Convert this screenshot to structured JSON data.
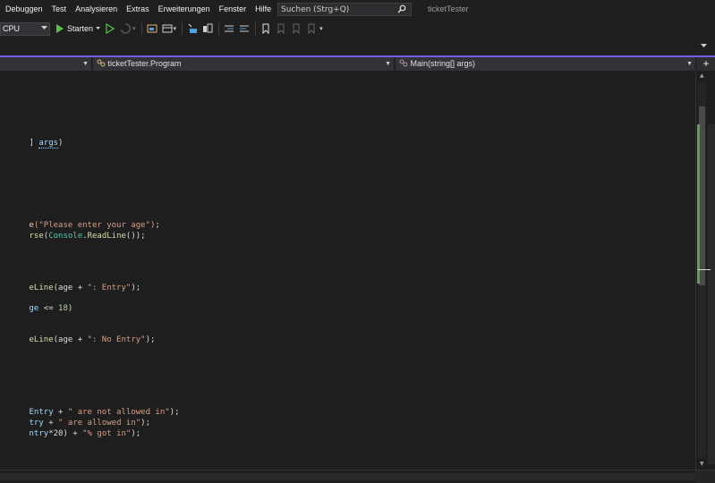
{
  "menu": {
    "items": [
      "Debuggen",
      "Test",
      "Analysieren",
      "Extras",
      "Erweiterungen",
      "Fenster",
      "Hilfe"
    ],
    "search_placeholder": "Suchen (Strg+Q)",
    "window_title": "ticketTester"
  },
  "toolbar": {
    "platform": "CPU",
    "start_label": "Starten"
  },
  "navbar": {
    "project": "",
    "class_name": "ticketTester.Program",
    "member": "Main(string[] args)"
  },
  "code": {
    "l1": {
      "a": "] ",
      "b": "args",
      "c": ")"
    },
    "l2": {
      "a": "e",
      "b": "(\"Please enter your age\")",
      "c": ";"
    },
    "l3": {
      "a": "rse",
      "b": "(",
      "c": "Console",
      "d": ".",
      "e": "ReadLine",
      "f": "());"
    },
    "l4": {
      "a": "eLine",
      "b": "(age + ",
      "c": "\": Entry\"",
      "d": ");"
    },
    "l5": {
      "a": "ge",
      "b": " <= ",
      "c": "18",
      "d": ")"
    },
    "l6": {
      "a": "eLine",
      "b": "(age + ",
      "c": "\": No Entry\"",
      "d": ");"
    },
    "l7": {
      "a": "Entry",
      "b": " + ",
      "c": "\" are not allowed in\"",
      "d": ");"
    },
    "l8": {
      "a": "try",
      "b": " + ",
      "c": "\" are allowed in\"",
      "d": ");"
    },
    "l9": {
      "a": "ntry",
      "b": "*20) + ",
      "c": "\"% got in\"",
      "d": ");"
    }
  },
  "colors": {
    "accent": "#7160e8",
    "change_marker": "#57a64a",
    "background": "#1e1e1e"
  }
}
